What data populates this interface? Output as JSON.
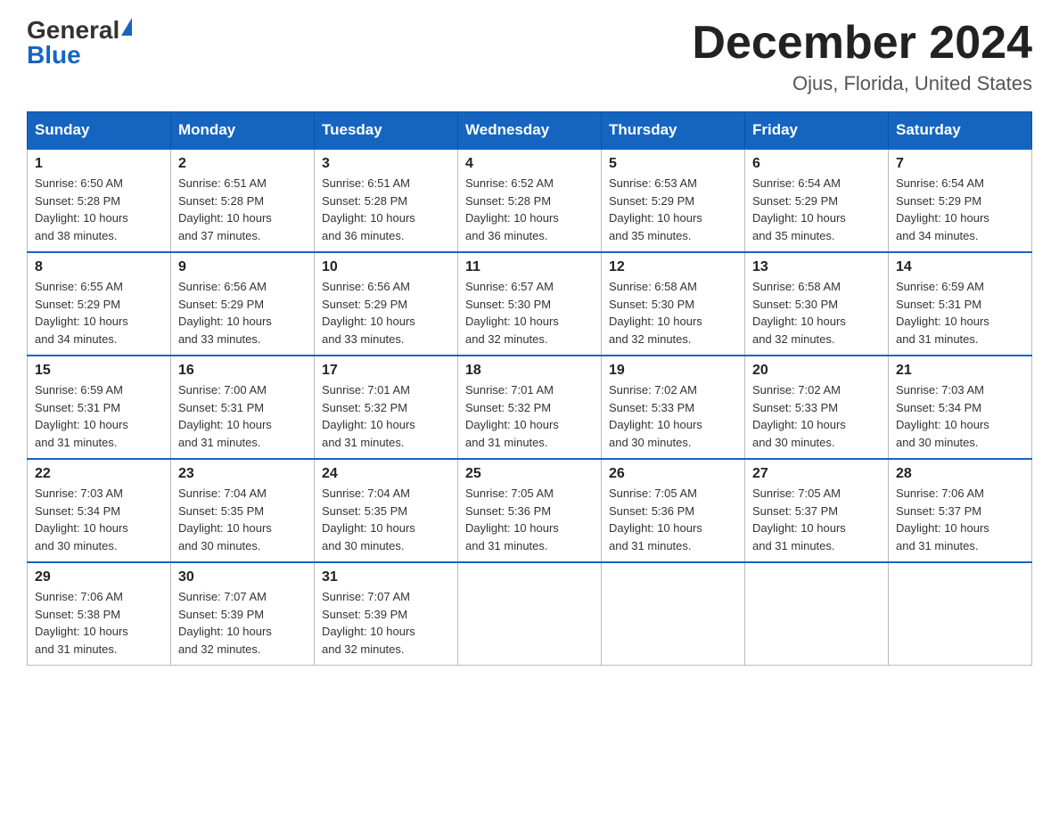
{
  "header": {
    "logo_general": "General",
    "logo_blue": "Blue",
    "month_year": "December 2024",
    "location": "Ojus, Florida, United States"
  },
  "columns": [
    "Sunday",
    "Monday",
    "Tuesday",
    "Wednesday",
    "Thursday",
    "Friday",
    "Saturday"
  ],
  "weeks": [
    [
      {
        "day": "1",
        "sunrise": "6:50 AM",
        "sunset": "5:28 PM",
        "daylight": "10 hours and 38 minutes."
      },
      {
        "day": "2",
        "sunrise": "6:51 AM",
        "sunset": "5:28 PM",
        "daylight": "10 hours and 37 minutes."
      },
      {
        "day": "3",
        "sunrise": "6:51 AM",
        "sunset": "5:28 PM",
        "daylight": "10 hours and 36 minutes."
      },
      {
        "day": "4",
        "sunrise": "6:52 AM",
        "sunset": "5:28 PM",
        "daylight": "10 hours and 36 minutes."
      },
      {
        "day": "5",
        "sunrise": "6:53 AM",
        "sunset": "5:29 PM",
        "daylight": "10 hours and 35 minutes."
      },
      {
        "day": "6",
        "sunrise": "6:54 AM",
        "sunset": "5:29 PM",
        "daylight": "10 hours and 35 minutes."
      },
      {
        "day": "7",
        "sunrise": "6:54 AM",
        "sunset": "5:29 PM",
        "daylight": "10 hours and 34 minutes."
      }
    ],
    [
      {
        "day": "8",
        "sunrise": "6:55 AM",
        "sunset": "5:29 PM",
        "daylight": "10 hours and 34 minutes."
      },
      {
        "day": "9",
        "sunrise": "6:56 AM",
        "sunset": "5:29 PM",
        "daylight": "10 hours and 33 minutes."
      },
      {
        "day": "10",
        "sunrise": "6:56 AM",
        "sunset": "5:29 PM",
        "daylight": "10 hours and 33 minutes."
      },
      {
        "day": "11",
        "sunrise": "6:57 AM",
        "sunset": "5:30 PM",
        "daylight": "10 hours and 32 minutes."
      },
      {
        "day": "12",
        "sunrise": "6:58 AM",
        "sunset": "5:30 PM",
        "daylight": "10 hours and 32 minutes."
      },
      {
        "day": "13",
        "sunrise": "6:58 AM",
        "sunset": "5:30 PM",
        "daylight": "10 hours and 32 minutes."
      },
      {
        "day": "14",
        "sunrise": "6:59 AM",
        "sunset": "5:31 PM",
        "daylight": "10 hours and 31 minutes."
      }
    ],
    [
      {
        "day": "15",
        "sunrise": "6:59 AM",
        "sunset": "5:31 PM",
        "daylight": "10 hours and 31 minutes."
      },
      {
        "day": "16",
        "sunrise": "7:00 AM",
        "sunset": "5:31 PM",
        "daylight": "10 hours and 31 minutes."
      },
      {
        "day": "17",
        "sunrise": "7:01 AM",
        "sunset": "5:32 PM",
        "daylight": "10 hours and 31 minutes."
      },
      {
        "day": "18",
        "sunrise": "7:01 AM",
        "sunset": "5:32 PM",
        "daylight": "10 hours and 31 minutes."
      },
      {
        "day": "19",
        "sunrise": "7:02 AM",
        "sunset": "5:33 PM",
        "daylight": "10 hours and 30 minutes."
      },
      {
        "day": "20",
        "sunrise": "7:02 AM",
        "sunset": "5:33 PM",
        "daylight": "10 hours and 30 minutes."
      },
      {
        "day": "21",
        "sunrise": "7:03 AM",
        "sunset": "5:34 PM",
        "daylight": "10 hours and 30 minutes."
      }
    ],
    [
      {
        "day": "22",
        "sunrise": "7:03 AM",
        "sunset": "5:34 PM",
        "daylight": "10 hours and 30 minutes."
      },
      {
        "day": "23",
        "sunrise": "7:04 AM",
        "sunset": "5:35 PM",
        "daylight": "10 hours and 30 minutes."
      },
      {
        "day": "24",
        "sunrise": "7:04 AM",
        "sunset": "5:35 PM",
        "daylight": "10 hours and 30 minutes."
      },
      {
        "day": "25",
        "sunrise": "7:05 AM",
        "sunset": "5:36 PM",
        "daylight": "10 hours and 31 minutes."
      },
      {
        "day": "26",
        "sunrise": "7:05 AM",
        "sunset": "5:36 PM",
        "daylight": "10 hours and 31 minutes."
      },
      {
        "day": "27",
        "sunrise": "7:05 AM",
        "sunset": "5:37 PM",
        "daylight": "10 hours and 31 minutes."
      },
      {
        "day": "28",
        "sunrise": "7:06 AM",
        "sunset": "5:37 PM",
        "daylight": "10 hours and 31 minutes."
      }
    ],
    [
      {
        "day": "29",
        "sunrise": "7:06 AM",
        "sunset": "5:38 PM",
        "daylight": "10 hours and 31 minutes."
      },
      {
        "day": "30",
        "sunrise": "7:07 AM",
        "sunset": "5:39 PM",
        "daylight": "10 hours and 32 minutes."
      },
      {
        "day": "31",
        "sunrise": "7:07 AM",
        "sunset": "5:39 PM",
        "daylight": "10 hours and 32 minutes."
      },
      null,
      null,
      null,
      null
    ]
  ],
  "labels": {
    "sunrise": "Sunrise:",
    "sunset": "Sunset:",
    "daylight": "Daylight:"
  }
}
